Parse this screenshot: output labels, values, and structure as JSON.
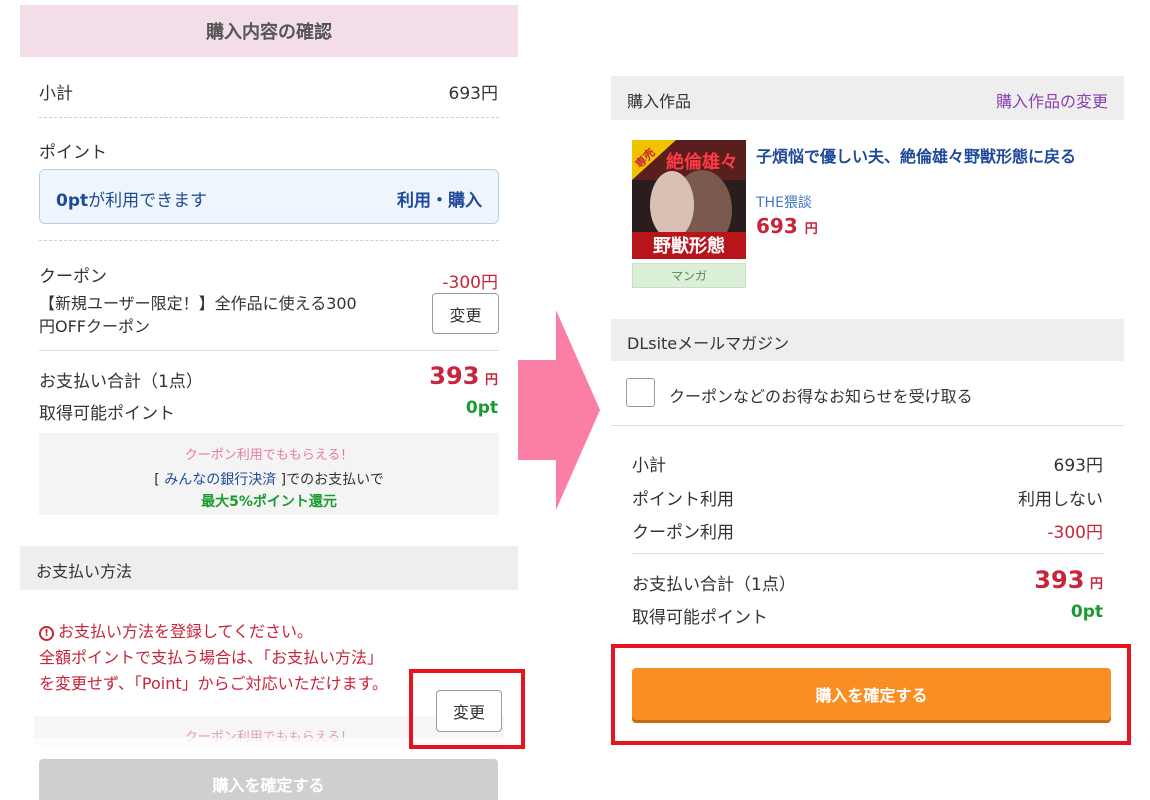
{
  "left": {
    "header_title": "購入内容の確認",
    "subtotal_label": "小計",
    "subtotal_value": "693円",
    "point_label": "ポイント",
    "point_available_amount": "0pt",
    "point_available_text": "が利用できます",
    "point_use_link": "利用・購入",
    "coupon_label": "クーポン",
    "coupon_discount": "-300円",
    "coupon_desc_line1": "【新規ユーザー限定！】全作品に使える300",
    "coupon_desc_line2": "円OFFクーポン",
    "coupon_change_button": "変更",
    "total_label": "お支払い合計（1点）",
    "total_amount": "393",
    "total_unit": "円",
    "earn_points_label": "取得可能ポイント",
    "earn_points_value": "0pt",
    "promo_line1": "クーポン利用でももらえる！",
    "promo_bracket_open": "[ ",
    "promo_link": "みんなの銀行決済",
    "promo_line2_suffix": " ]でのお支払いで",
    "promo_line3": "最大5%ポイント還元",
    "payment_method_head": "お支払い方法",
    "warning_icon": "!",
    "warning_line1": "お支払い方法を登録してください。",
    "warning_line2": "全額ポイントで支払う場合は、「お支払い方法」",
    "warning_line3": "を変更せず、「Point」からご対応いただけます。",
    "payment_change_button": "変更",
    "faded_promo": "クーポン利用でももらえる！",
    "confirm_button": "購入を確定する"
  },
  "right": {
    "work_head": "購入作品",
    "work_change_link": "購入作品の変更",
    "work_title": "子煩悩で優しい夫、絶倫雄々野獣形態に戻る",
    "work_circle": "THE猥談",
    "work_price": "693",
    "work_price_unit": "円",
    "exclusive_badge": "専売",
    "genre_tag": "マンガ",
    "magazine_head": "DLsiteメールマガジン",
    "magazine_checkbox_label": "クーポンなどのお得なお知らせを受け取る",
    "magazine_checked": false,
    "subtotal_label": "小計",
    "subtotal_value": "693円",
    "point_use_label": "ポイント利用",
    "point_use_value": "利用しない",
    "coupon_use_label": "クーポン利用",
    "coupon_use_value": "-300円",
    "total_label": "お支払い合計（1点）",
    "total_amount": "393",
    "total_unit": "円",
    "earn_points_label": "取得可能ポイント",
    "earn_points_value": "0pt",
    "confirm_button": "購入を確定する"
  },
  "colors": {
    "header_pink": "#f3dde9",
    "price_red": "#c8243a",
    "point_green": "#1a9b2f",
    "confirm_orange": "#f88e24",
    "highlight_red": "#e6141e",
    "arrow_pink": "#fb7fa5",
    "link_blue": "#1f4a9a",
    "link_purple": "#8a3fb5"
  }
}
